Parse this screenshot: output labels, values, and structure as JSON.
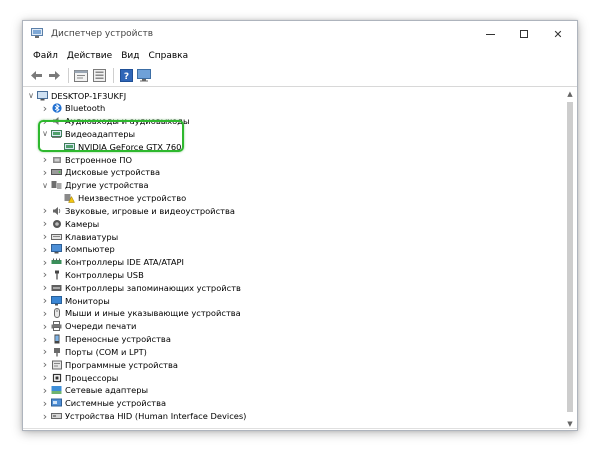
{
  "window": {
    "title": "Диспетчер устройств",
    "min_glyph": "",
    "max_glyph": "",
    "close_glyph": "✕"
  },
  "menu": [
    "Файл",
    "Действие",
    "Вид",
    "Справка"
  ],
  "toolbar_icons": [
    "back-arrow-icon",
    "forward-arrow-icon",
    "properties-icon",
    "help-window-icon",
    "help-question-icon",
    "monitor-scan-icon"
  ],
  "tree": {
    "root": "DESKTOP-1F3UKFJ",
    "items": [
      {
        "label": "Bluetooth",
        "icon": "bluetooth-icon",
        "state": "collapsed",
        "level": 1
      },
      {
        "label": "Аудиовходы и аудиовыходы",
        "icon": "speaker-icon",
        "state": "collapsed",
        "level": 1
      },
      {
        "label": "Видеоадаптеры",
        "icon": "display-adapter-icon",
        "state": "expanded",
        "level": 1
      },
      {
        "label": "NVIDIA GeForce GTX 760",
        "icon": "display-adapter-icon",
        "state": "leaf",
        "level": 2
      },
      {
        "label": "Встроенное ПО",
        "icon": "firmware-icon",
        "state": "collapsed",
        "level": 1
      },
      {
        "label": "Дисковые устройства",
        "icon": "disk-drive-icon",
        "state": "collapsed",
        "level": 1
      },
      {
        "label": "Другие устройства",
        "icon": "other-devices-icon",
        "state": "expanded",
        "level": 1
      },
      {
        "label": "Неизвестное устройство",
        "icon": "unknown-device-warning-icon",
        "state": "leaf",
        "level": 2
      },
      {
        "label": "Звуковые, игровые и видеоустройства",
        "icon": "sound-icon",
        "state": "collapsed",
        "level": 1
      },
      {
        "label": "Камеры",
        "icon": "camera-icon",
        "state": "collapsed",
        "level": 1
      },
      {
        "label": "Клавиатуры",
        "icon": "keyboard-icon",
        "state": "collapsed",
        "level": 1
      },
      {
        "label": "Компьютер",
        "icon": "computer-icon",
        "state": "collapsed",
        "level": 1
      },
      {
        "label": "Контроллеры IDE ATA/ATAPI",
        "icon": "ide-controller-icon",
        "state": "collapsed",
        "level": 1
      },
      {
        "label": "Контроллеры USB",
        "icon": "usb-icon",
        "state": "collapsed",
        "level": 1
      },
      {
        "label": "Контроллеры запоминающих устройств",
        "icon": "storage-controller-icon",
        "state": "collapsed",
        "level": 1
      },
      {
        "label": "Мониторы",
        "icon": "monitor-icon",
        "state": "collapsed",
        "level": 1
      },
      {
        "label": "Мыши и иные указывающие устройства",
        "icon": "mouse-icon",
        "state": "collapsed",
        "level": 1
      },
      {
        "label": "Очереди печати",
        "icon": "printer-icon",
        "state": "collapsed",
        "level": 1
      },
      {
        "label": "Переносные устройства",
        "icon": "portable-device-icon",
        "state": "collapsed",
        "level": 1
      },
      {
        "label": "Порты (COM и LPT)",
        "icon": "port-icon",
        "state": "collapsed",
        "level": 1
      },
      {
        "label": "Программные устройства",
        "icon": "software-device-icon",
        "state": "collapsed",
        "level": 1
      },
      {
        "label": "Процессоры",
        "icon": "processor-icon",
        "state": "collapsed",
        "level": 1
      },
      {
        "label": "Сетевые адаптеры",
        "icon": "network-adapter-icon",
        "state": "collapsed",
        "level": 1
      },
      {
        "label": "Системные устройства",
        "icon": "system-device-icon",
        "state": "collapsed",
        "level": 1
      },
      {
        "label": "Устройства HID (Human Interface Devices)",
        "icon": "hid-icon",
        "state": "collapsed",
        "level": 1
      }
    ]
  },
  "colors": {
    "highlight": "#2eb82e",
    "window_border": "#aeb4bd"
  }
}
